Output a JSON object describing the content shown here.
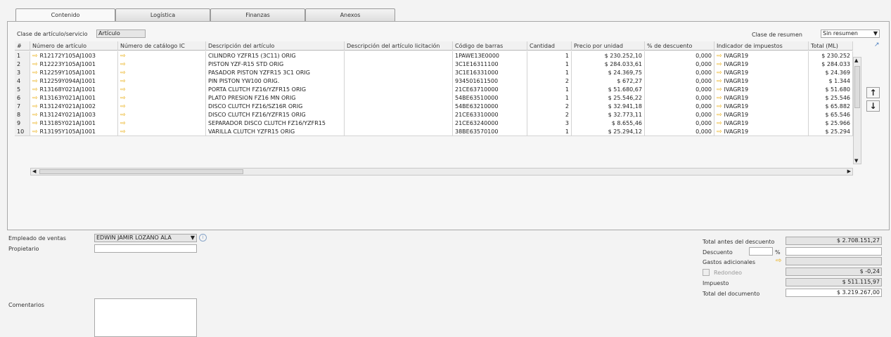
{
  "tabs": [
    "Contenido",
    "Logística",
    "Finanzas",
    "Anexos"
  ],
  "item_class": {
    "label": "Clase de artículo/servicio",
    "value": "Artículo"
  },
  "summary_class": {
    "label": "Clase de resumen",
    "value": "Sin resumen"
  },
  "columns": [
    "#",
    "Número de artículo",
    "Número de catálogo IC",
    "Descripción del artículo",
    "Descripción del artículo licitación",
    "Código de barras",
    "Cantidad",
    "Precio por unidad",
    "% de descuento",
    "Indicador de impuestos",
    "Total (ML)"
  ],
  "rows": [
    {
      "n": "1",
      "item": "R12172Y105AJ1003",
      "desc": "CILINDRO YZFR15 (3C11) ORIG",
      "bar": "1PAWE13E0000",
      "qty": "1",
      "price": "$ 230.252,10",
      "disc": "0,000",
      "tax": "IVAGR19",
      "total": "$ 230.252"
    },
    {
      "n": "2",
      "item": "R12223Y105AJ1001",
      "desc": "PISTON YZF-R15 STD ORIG",
      "bar": "3C1E16311100",
      "qty": "1",
      "price": "$ 284.033,61",
      "disc": "0,000",
      "tax": "IVAGR19",
      "total": "$ 284.033"
    },
    {
      "n": "3",
      "item": "R12259Y105AJ1001",
      "desc": "PASADOR PISTON YZFR15 3C1 ORIG",
      "bar": "3C1E16331000",
      "qty": "1",
      "price": "$ 24.369,75",
      "disc": "0,000",
      "tax": "IVAGR19",
      "total": "$ 24.369"
    },
    {
      "n": "4",
      "item": "R12259Y094AJ1001",
      "desc": "PIN PISTON YW100 ORIG.",
      "bar": "934501611500",
      "qty": "2",
      "price": "$ 672,27",
      "disc": "0,000",
      "tax": "IVAGR19",
      "total": "$ 1.344"
    },
    {
      "n": "5",
      "item": "R13168Y021AJ1001",
      "desc": "PORTA CLUTCH FZ16/YZFR15 ORIG",
      "bar": "21CE63710000",
      "qty": "1",
      "price": "$ 51.680,67",
      "disc": "0,000",
      "tax": "IVAGR19",
      "total": "$ 51.680"
    },
    {
      "n": "6",
      "item": "R13163Y021AJ1001",
      "desc": "PLATO PRESION FZ16 MN ORIG",
      "bar": "54BE63510000",
      "qty": "1",
      "price": "$ 25.546,22",
      "disc": "0,000",
      "tax": "IVAGR19",
      "total": "$ 25.546"
    },
    {
      "n": "7",
      "item": "R13124Y021AJ1002",
      "desc": "DISCO CLUTCH FZ16/SZ16R ORIG",
      "bar": "54BE63210000",
      "qty": "2",
      "price": "$ 32.941,18",
      "disc": "0,000",
      "tax": "IVAGR19",
      "total": "$ 65.882"
    },
    {
      "n": "8",
      "item": "R13124Y021AJ1003",
      "desc": "DISCO CLUTCH FZ16/YZFR15 ORIG",
      "bar": "21CE63310000",
      "qty": "2",
      "price": "$ 32.773,11",
      "disc": "0,000",
      "tax": "IVAGR19",
      "total": "$ 65.546"
    },
    {
      "n": "9",
      "item": "R13185Y021AJ1001",
      "desc": "SEPARADOR DISCO CLUTCH FZ16/YZFR15",
      "bar": "21CE63240000",
      "qty": "3",
      "price": "$ 8.655,46",
      "disc": "0,000",
      "tax": "IVAGR19",
      "total": "$ 25.966"
    },
    {
      "n": "10",
      "item": "R13195Y105AJ1001",
      "desc": "VARILLA CLUTCH YZFR15 ORIG",
      "bar": "38BE63570100",
      "qty": "1",
      "price": "$ 25.294,12",
      "disc": "0,000",
      "tax": "IVAGR19",
      "total": "$ 25.294"
    }
  ],
  "footer": {
    "sales_employee_label": "Empleado de ventas",
    "sales_employee_value": "EDWIN JAMIR LOZANO ALA",
    "owner_label": "Propietario",
    "owner_value": "",
    "comments_label": "Comentarios"
  },
  "totals": {
    "before_discount_label": "Total antes del descuento",
    "before_discount_value": "$ 2.708.151,27",
    "discount_label": "Descuento",
    "percent_sign": "%",
    "extra_costs_label": "Gastos adicionales",
    "rounding_label": "Redondeo",
    "rounding_value": "$ -0,24",
    "tax_label": "Impuesto",
    "tax_value": "$ 511.115,97",
    "total_label": "Total del documento",
    "total_value": "$ 3.219.267,00"
  },
  "colors": {
    "arrow": "#e8a800",
    "border": "#a8a8a8"
  }
}
